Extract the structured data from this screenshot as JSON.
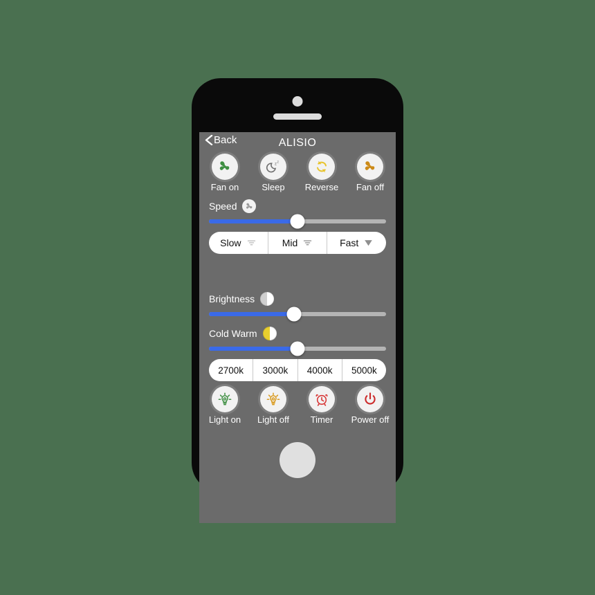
{
  "device": {
    "camera": "camera-dot",
    "speaker": "speaker-grille",
    "home_button": "home-button"
  },
  "screen": {
    "background_color": "#6b6b6b",
    "accent_color": "#3a6ae8",
    "navbar": {
      "back_label": "Back",
      "back_icon": "chevron-left-icon",
      "title": "ALISIO"
    },
    "fan_actions": [
      {
        "label": "Fan on",
        "icon": "fan-icon",
        "color": "#3f8f43"
      },
      {
        "label": "Sleep",
        "icon": "moon-zzz-icon",
        "color": "#6e6e6e"
      },
      {
        "label": "Reverse",
        "icon": "circular-arrows-icon",
        "color": "#e8c42e"
      },
      {
        "label": "Fan off",
        "icon": "fan-icon",
        "color": "#cc8a18"
      }
    ],
    "speed": {
      "label": "Speed",
      "icon": "fan-badge-icon",
      "value_percent": 50
    },
    "fan_speed_modes": [
      {
        "label": "Slow",
        "icon": "wind-slow-icon"
      },
      {
        "label": "Mid",
        "icon": "wind-mid-icon"
      },
      {
        "label": "Fast",
        "icon": "wind-fast-icon"
      }
    ],
    "brightness": {
      "label": "Brightness",
      "icon": "half-circle-gray-icon",
      "value_percent": 48
    },
    "cold_warm": {
      "label": "Cold Warm",
      "icon": "half-circle-warm-icon",
      "value_percent": 50
    },
    "color_temperatures": [
      {
        "label": "2700k"
      },
      {
        "label": "3000k"
      },
      {
        "label": "4000k"
      },
      {
        "label": "5000k"
      }
    ],
    "light_actions": [
      {
        "label": "Light on",
        "icon": "bulb-on-icon",
        "color": "#3f8f43"
      },
      {
        "label": "Light off",
        "icon": "bulb-off-icon",
        "color": "#d99a1e"
      },
      {
        "label": "Timer",
        "icon": "alarm-clock-icon",
        "color": "#d83a3a"
      },
      {
        "label": "Power off",
        "icon": "power-icon",
        "color": "#cc2a2a"
      }
    ]
  }
}
